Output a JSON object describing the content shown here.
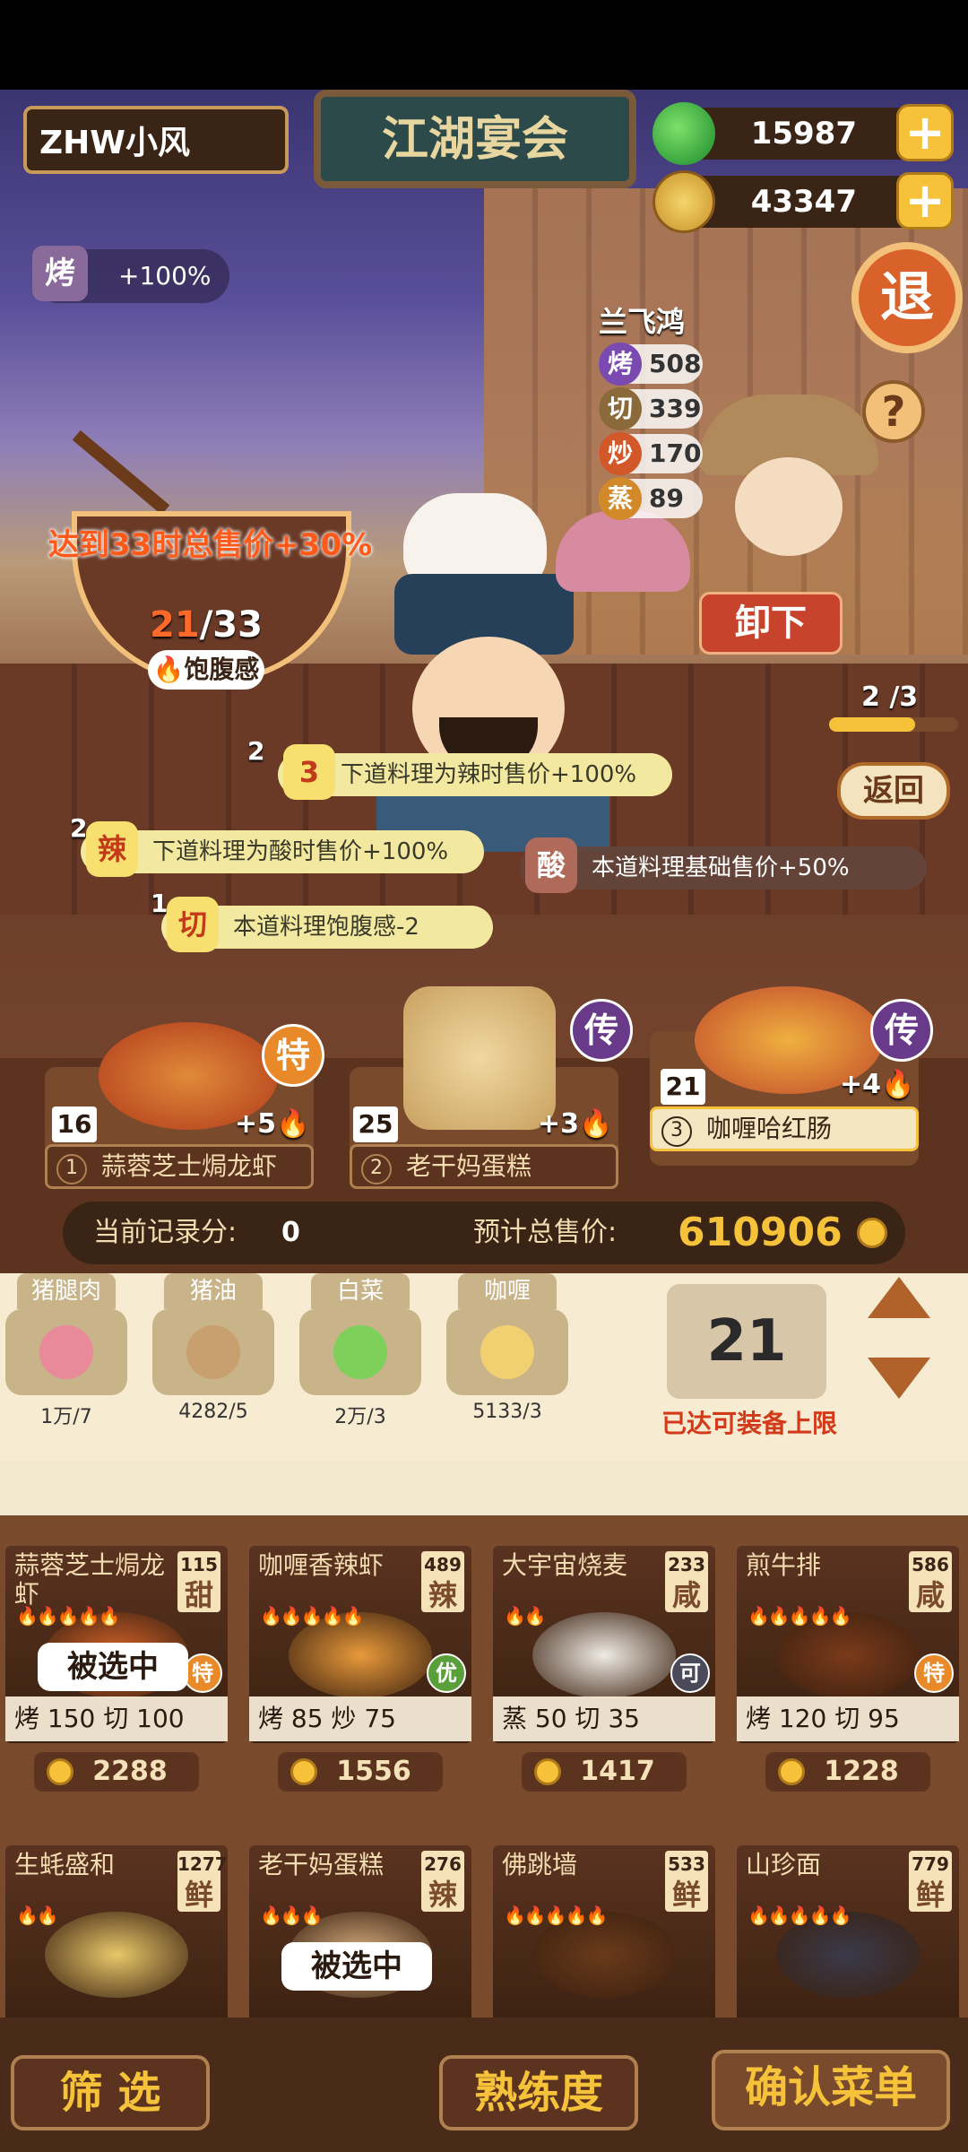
{
  "player": {
    "name": "ZHW小风"
  },
  "event_title": "江湖宴会",
  "currency": {
    "jade": "15987",
    "coins": "43347",
    "plus": "+"
  },
  "buttons": {
    "exit": "退",
    "help": "?",
    "unload": "卸下",
    "back": "返回",
    "filter": "筛 选",
    "proficiency": "熟练度",
    "confirm_menu": "确认菜单"
  },
  "buff": {
    "tag": "烤",
    "value": "+100%"
  },
  "chef": {
    "name": "兰飞鸿",
    "stats": [
      {
        "skill": "烤",
        "value": "508",
        "color": "#7a4ab0"
      },
      {
        "skill": "切",
        "value": "339",
        "color": "#8a6a3a"
      },
      {
        "skill": "炒",
        "value": "170",
        "color": "#d2582a"
      },
      {
        "skill": "蒸",
        "value": "89",
        "color": "#d2892a"
      }
    ]
  },
  "progress": {
    "current": "2",
    "sep": "/3",
    "fraction": 0.6667
  },
  "satiety": {
    "goal_text": "达到33时总售价+30%",
    "current": "21",
    "sep": "/33",
    "label": "饱腹感"
  },
  "combos": [
    {
      "num": "2",
      "badge": "3",
      "text": "下道料理为辣时售价+100%"
    },
    {
      "num": "2",
      "badge": "辣",
      "text": "下道料理为酸时售价+100%"
    },
    {
      "num": "",
      "badge": "酸",
      "text": "本道料理基础售价+50%"
    },
    {
      "num": "1",
      "badge": "切",
      "text": "本道料理饱腹感-2"
    }
  ],
  "slots": [
    {
      "idx": "1",
      "qty": "16",
      "name": "蒜蓉芝士焗龙虾",
      "bonus": "+5",
      "grade": "特"
    },
    {
      "idx": "2",
      "qty": "25",
      "name": "老干妈蛋糕",
      "bonus": "+3",
      "grade": "传"
    },
    {
      "idx": "3",
      "qty": "21",
      "name": "咖喱哈红肠",
      "bonus": "+4",
      "grade": "传"
    }
  ],
  "score": {
    "current_label": "当前记录分:",
    "current_value": "0",
    "total_label": "预计总售价:",
    "total_value": "610906"
  },
  "ingredients": [
    {
      "name": "猪腿肉",
      "count": "1万/7"
    },
    {
      "name": "猪油",
      "count": "4282/5"
    },
    {
      "name": "白菜",
      "count": "2万/3"
    },
    {
      "name": "咖喱",
      "count": "5133/3"
    }
  ],
  "equip": {
    "count": "21",
    "limit_text": "已达可装备上限"
  },
  "recipes": [
    {
      "name": "蒜蓉芝士焗龙虾",
      "price": "115",
      "taste": "甜",
      "flames": "🔥🔥🔥🔥🔥",
      "skills": "烤 150  切 100",
      "cost": "2288",
      "grade": "特",
      "selected": "被选中"
    },
    {
      "name": "咖喱香辣虾",
      "price": "489",
      "taste": "辣",
      "flames": "🔥🔥🔥🔥🔥",
      "skills": "烤 85  炒 75",
      "cost": "1556",
      "grade": "优",
      "selected": ""
    },
    {
      "name": "大宇宙烧麦",
      "price": "233",
      "taste": "咸",
      "flames": "🔥🔥",
      "skills": "蒸 50  切 35",
      "cost": "1417",
      "grade": "可",
      "selected": ""
    },
    {
      "name": "煎牛排",
      "price": "586",
      "taste": "咸",
      "flames": "🔥🔥🔥🔥🔥",
      "skills": "烤 120  切 95",
      "cost": "1228",
      "grade": "特",
      "selected": ""
    },
    {
      "name": "生蚝盛和",
      "price": "1277",
      "taste": "鲜",
      "flames": "🔥🔥",
      "skills": "",
      "cost": "",
      "grade": "",
      "selected": ""
    },
    {
      "name": "老干妈蛋糕",
      "price": "276",
      "taste": "辣",
      "flames": "🔥🔥🔥",
      "skills": "",
      "cost": "",
      "grade": "",
      "selected": "被选中"
    },
    {
      "name": "佛跳墙",
      "price": "533",
      "taste": "鲜",
      "flames": "🔥🔥🔥🔥🔥",
      "skills": "",
      "cost": "",
      "grade": "",
      "selected": ""
    },
    {
      "name": "山珍面",
      "price": "779",
      "taste": "鲜",
      "flames": "🔥🔥🔥🔥🔥",
      "skills": "",
      "cost": "",
      "grade": "",
      "selected": ""
    }
  ],
  "colors": {
    "accent": "#f5c23a",
    "panel": "#f7ecd2",
    "wood": "#7a4a2c"
  }
}
